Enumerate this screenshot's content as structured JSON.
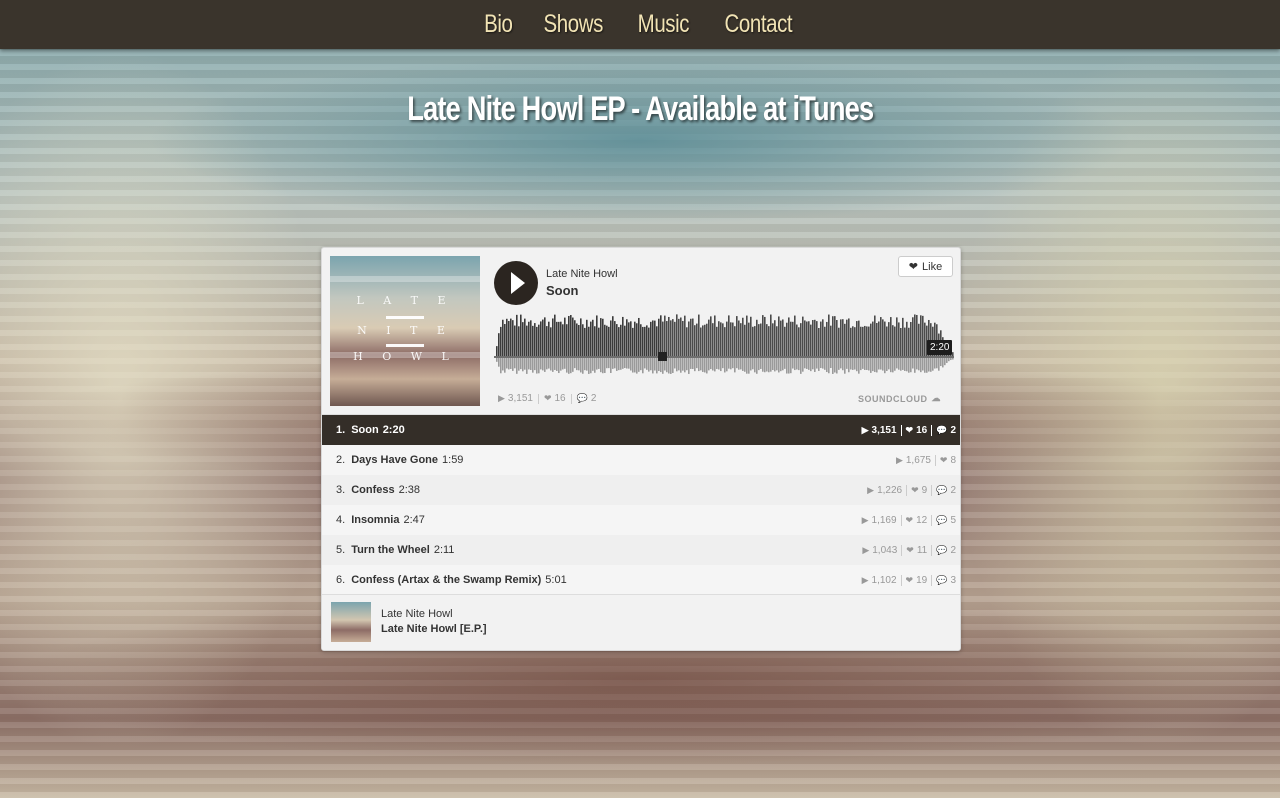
{
  "nav": {
    "items": [
      {
        "label": "Bio"
      },
      {
        "label": "Shows"
      },
      {
        "label": "Music"
      },
      {
        "label": "Contact"
      }
    ]
  },
  "headline": "Late Nite Howl EP - Available at iTunes",
  "player": {
    "cover_letters": [
      "L A T E",
      "N I T E",
      "H O W L"
    ],
    "artist": "Late Nite Howl",
    "current_track": "Soon",
    "like_label": "Like",
    "duration": "2:20",
    "stats": {
      "plays": "3,151",
      "likes": "16",
      "comments": "2"
    },
    "brand": "SOUNDCLOUD",
    "tracks": [
      {
        "num": "1.",
        "name": "Soon",
        "dur": "2:20",
        "plays": "3,151",
        "likes": "16",
        "comments": "2"
      },
      {
        "num": "2.",
        "name": "Days Have Gone",
        "dur": "1:59",
        "plays": "1,675",
        "likes": "8",
        "comments": ""
      },
      {
        "num": "3.",
        "name": "Confess",
        "dur": "2:38",
        "plays": "1,226",
        "likes": "9",
        "comments": "2"
      },
      {
        "num": "4.",
        "name": "Insomnia",
        "dur": "2:47",
        "plays": "1,169",
        "likes": "12",
        "comments": "5"
      },
      {
        "num": "5.",
        "name": "Turn the Wheel",
        "dur": "2:11",
        "plays": "1,043",
        "likes": "11",
        "comments": "2"
      },
      {
        "num": "6.",
        "name": "Confess (Artax & the Swamp Remix)",
        "dur": "5:01",
        "plays": "1,102",
        "likes": "19",
        "comments": "3"
      }
    ],
    "footer": {
      "artist": "Late Nite Howl",
      "album": "Late Nite Howl [E.P.]"
    }
  },
  "colors": {
    "nav_bg": "#3a342c",
    "nav_text": "#f1e3b4",
    "active_row": "#342e28"
  }
}
